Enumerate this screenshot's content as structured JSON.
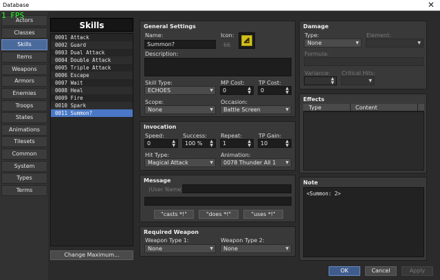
{
  "window": {
    "title": "Database",
    "close_glyph": "✕"
  },
  "overlay": {
    "fps": "1 FPS"
  },
  "sidebar": {
    "items": [
      {
        "label": "Actors"
      },
      {
        "label": "Classes"
      },
      {
        "label": "Skills"
      },
      {
        "label": "Items"
      },
      {
        "label": "Weapons"
      },
      {
        "label": "Armors"
      },
      {
        "label": "Enemies"
      },
      {
        "label": "Troops"
      },
      {
        "label": "States"
      },
      {
        "label": "Animations"
      },
      {
        "label": "Tilesets"
      },
      {
        "label": "Common Events"
      },
      {
        "label": "System"
      },
      {
        "label": "Types"
      },
      {
        "label": "Terms"
      }
    ],
    "selected": "Skills"
  },
  "skills_list": {
    "title": "Skills",
    "items": [
      "0001 Attack",
      "0002 Guard",
      "0003 Dual Attack",
      "0004 Double Attack",
      "0005 Triple Attack",
      "0006 Escape",
      "0007 Wait",
      "0008 Heal",
      "0009 Fire",
      "0010 Spark",
      "0011 Summon?"
    ],
    "selected": "0011 Summon?",
    "change_maximum": "Change Maximum..."
  },
  "general": {
    "title": "General Settings",
    "name_label": "Name:",
    "name_value": "Summon?",
    "icon_label": "Icon:",
    "icon_index": "66",
    "description_label": "Description:",
    "description_value": "",
    "skill_type_label": "Skill Type:",
    "skill_type_value": "ECHOES",
    "mp_cost_label": "MP Cost:",
    "mp_cost_value": "0",
    "tp_cost_label": "TP Cost:",
    "tp_cost_value": "0",
    "scope_label": "Scope:",
    "scope_value": "None",
    "occasion_label": "Occasion:",
    "occasion_value": "Battle Screen"
  },
  "invocation": {
    "title": "Invocation",
    "speed_label": "Speed:",
    "speed_value": "0",
    "success_label": "Success:",
    "success_value": "100 %",
    "repeat_label": "Repeat:",
    "repeat_value": "1",
    "tp_gain_label": "TP Gain:",
    "tp_gain_value": "10",
    "hit_type_label": "Hit Type:",
    "hit_type_value": "Magical Attack",
    "animation_label": "Animation:",
    "animation_value": "0078 Thunder All 1"
  },
  "message": {
    "title": "Message",
    "user_name_placeholder": "(User Name)",
    "line1": "",
    "line2": "",
    "buttons": [
      "\"casts *!\"",
      "\"does *!\"",
      "\"uses *!\""
    ]
  },
  "required_weapon": {
    "title": "Required Weapon",
    "type1_label": "Weapon Type 1:",
    "type1_value": "None",
    "type2_label": "Weapon Type 2:",
    "type2_value": "None"
  },
  "damage": {
    "title": "Damage",
    "type_label": "Type:",
    "type_value": "None",
    "element_label": "Element:",
    "element_value": "",
    "formula_label": "Formula:",
    "formula_value": "",
    "variance_label": "Variance:",
    "variance_value": "",
    "critical_label": "Critical Hits:",
    "critical_value": ""
  },
  "effects": {
    "title": "Effects",
    "columns": [
      "Type",
      "Content"
    ]
  },
  "note": {
    "title": "Note",
    "text": "<Summon: 2>"
  },
  "footer": {
    "ok": "OK",
    "cancel": "Cancel",
    "apply": "Apply"
  },
  "colors": {
    "accent": "#4a78c6",
    "background": "#2b2b2b",
    "panel": "#393939",
    "fps_text": "#22ff22"
  }
}
